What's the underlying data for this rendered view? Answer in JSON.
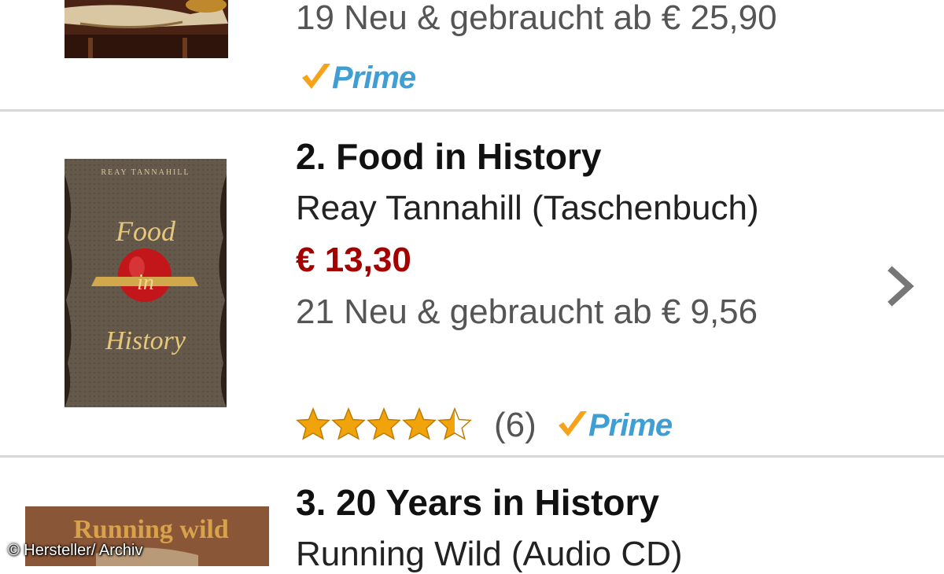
{
  "items": [
    {
      "title": "",
      "used_offer": "19 Neu & gebraucht ab € 25,90",
      "prime_label": "Prime"
    },
    {
      "title": "2. Food in History",
      "author_format": "Reay Tannahill (Taschenbuch)",
      "price": "€ 13,30",
      "used_offer": "21 Neu & gebraucht ab € 9,56",
      "rating": 4.5,
      "review_count": "(6)",
      "prime_label": "Prime",
      "cover": {
        "top_text": "REAY TANNAHILL",
        "word1": "Food",
        "word2": "in",
        "word3": "History"
      }
    },
    {
      "title": "3. 20 Years in History",
      "author_format": "Running Wild (Audio CD)",
      "cover": {
        "band_text": "Running wild"
      }
    }
  ],
  "watermark": "© Hersteller/ Archiv",
  "colors": {
    "price": "#a40000",
    "prime_blue": "#3f9fd4",
    "prime_check": "#f7a21b",
    "star": "#f0a30a"
  }
}
